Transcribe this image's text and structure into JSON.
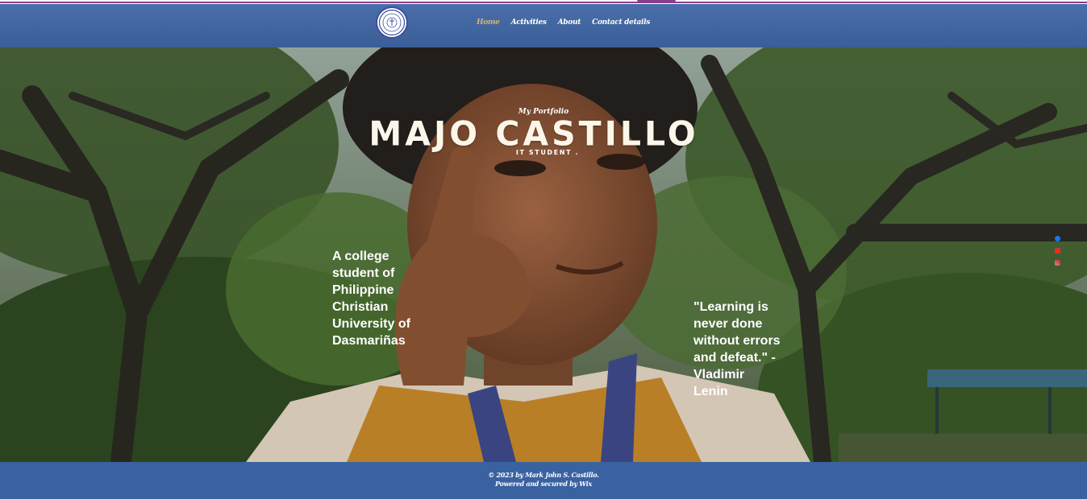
{
  "colors": {
    "header": "#3f64a0",
    "footer": "#3a62a1",
    "nav_active": "#d9b46f",
    "name_text": "#fbf6e9",
    "accent": "#8a3d8f"
  },
  "header": {
    "logo_icon": "university-seal-icon",
    "nav": [
      {
        "label": "Home",
        "active": true
      },
      {
        "label": "Activities",
        "active": false
      },
      {
        "label": "About",
        "active": false
      },
      {
        "label": "Contact details",
        "active": false
      }
    ]
  },
  "hero": {
    "tagline": "My Portfolio",
    "name": "MAJO CASTILLO",
    "subtitle": "IT STUDENT .",
    "intro": "A college student of Philippine Christian University of Dasmariñas",
    "quote": "\"Learning is never done without errors and defeat.\" - Vladimir Lenin",
    "social": [
      "facebook-icon",
      "youtube-icon",
      "instagram-icon"
    ]
  },
  "footer": {
    "copyright": "© 2023 by Mark John S. Castillo.",
    "powered": "Powered and secured by Wix"
  }
}
